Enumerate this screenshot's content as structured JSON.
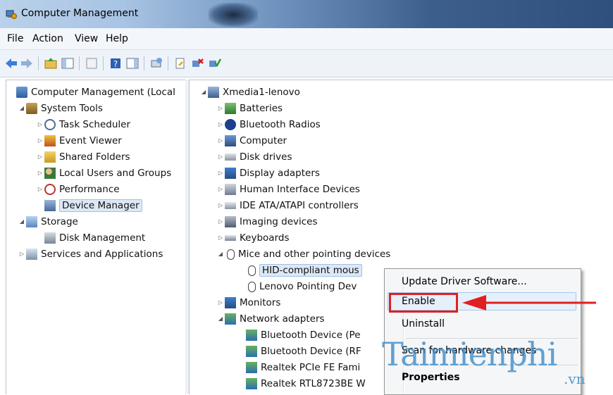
{
  "window": {
    "title": "Computer Management"
  },
  "menu": [
    "File",
    "Action",
    "View",
    "Help"
  ],
  "left_tree": [
    {
      "label": "Computer Management (Local",
      "icon": "computer-management-icon",
      "twisty": "",
      "indent": 0
    },
    {
      "label": "System Tools",
      "icon": "system-tools-icon",
      "twisty": "◢",
      "indent": 1
    },
    {
      "label": "Task Scheduler",
      "icon": "clock-icon",
      "twisty": "▷",
      "indent": 2
    },
    {
      "label": "Event Viewer",
      "icon": "event-viewer-icon",
      "twisty": "▷",
      "indent": 2
    },
    {
      "label": "Shared Folders",
      "icon": "shared-folder-icon",
      "twisty": "▷",
      "indent": 2
    },
    {
      "label": "Local Users and Groups",
      "icon": "users-icon",
      "twisty": "▷",
      "indent": 2
    },
    {
      "label": "Performance",
      "icon": "performance-icon",
      "twisty": "▷",
      "indent": 2
    },
    {
      "label": "Device Manager",
      "icon": "device-manager-icon",
      "twisty": "",
      "indent": 2,
      "selected": true
    },
    {
      "label": "Storage",
      "icon": "storage-icon",
      "twisty": "◢",
      "indent": 1
    },
    {
      "label": "Disk Management",
      "icon": "disk-management-icon",
      "twisty": "",
      "indent": 2
    },
    {
      "label": "Services and Applications",
      "icon": "services-icon",
      "twisty": "▷",
      "indent": 1
    }
  ],
  "device_tree": [
    {
      "label": "Xmedia1-lenovo",
      "icon": "computer-icon",
      "twisty": "◢",
      "indent": 0
    },
    {
      "label": "Batteries",
      "icon": "battery-icon",
      "twisty": "▷",
      "indent": 1
    },
    {
      "label": "Bluetooth Radios",
      "icon": "bluetooth-icon",
      "twisty": "▷",
      "indent": 1
    },
    {
      "label": "Computer",
      "icon": "computer-icon",
      "twisty": "▷",
      "indent": 1
    },
    {
      "label": "Disk drives",
      "icon": "disk-drive-icon",
      "twisty": "▷",
      "indent": 1
    },
    {
      "label": "Display adapters",
      "icon": "display-adapter-icon",
      "twisty": "▷",
      "indent": 1
    },
    {
      "label": "Human Interface Devices",
      "icon": "hid-icon",
      "twisty": "▷",
      "indent": 1
    },
    {
      "label": "IDE ATA/ATAPI controllers",
      "icon": "ide-controller-icon",
      "twisty": "▷",
      "indent": 1
    },
    {
      "label": "Imaging devices",
      "icon": "imaging-icon",
      "twisty": "▷",
      "indent": 1
    },
    {
      "label": "Keyboards",
      "icon": "keyboard-icon",
      "twisty": "▷",
      "indent": 1
    },
    {
      "label": "Mice and other pointing devices",
      "icon": "mouse-icon",
      "twisty": "◢",
      "indent": 1
    },
    {
      "label": "HID-compliant mous",
      "icon": "mouse-disabled-icon",
      "twisty": "",
      "indent": 2,
      "selected": true
    },
    {
      "label": "Lenovo Pointing Dev",
      "icon": "mouse-icon",
      "twisty": "",
      "indent": 2
    },
    {
      "label": "Monitors",
      "icon": "monitor-icon",
      "twisty": "▷",
      "indent": 1
    },
    {
      "label": "Network adapters",
      "icon": "network-icon",
      "twisty": "◢",
      "indent": 1
    },
    {
      "label": "Bluetooth Device (Pe",
      "icon": "network-adapter-icon",
      "twisty": "",
      "indent": 2
    },
    {
      "label": "Bluetooth Device (RF",
      "icon": "network-adapter-icon",
      "twisty": "",
      "indent": 2
    },
    {
      "label": "Realtek PCIe FE Fami",
      "icon": "network-adapter-icon",
      "twisty": "",
      "indent": 2
    },
    {
      "label": "Realtek RTL8723BE W",
      "icon": "network-adapter-icon",
      "twisty": "",
      "indent": 2
    }
  ],
  "context_menu": {
    "update": "Update Driver Software...",
    "enable": "Enable",
    "uninstall": "Uninstall",
    "scan": "Scan for hardware changes",
    "properties": "Properties"
  },
  "watermark": {
    "main": "Taimienphi",
    "suffix": ".vn"
  },
  "colors": {
    "highlight_red": "#e02020",
    "watermark_blue": "#3c8cc8",
    "selection": "#dde8f6"
  }
}
